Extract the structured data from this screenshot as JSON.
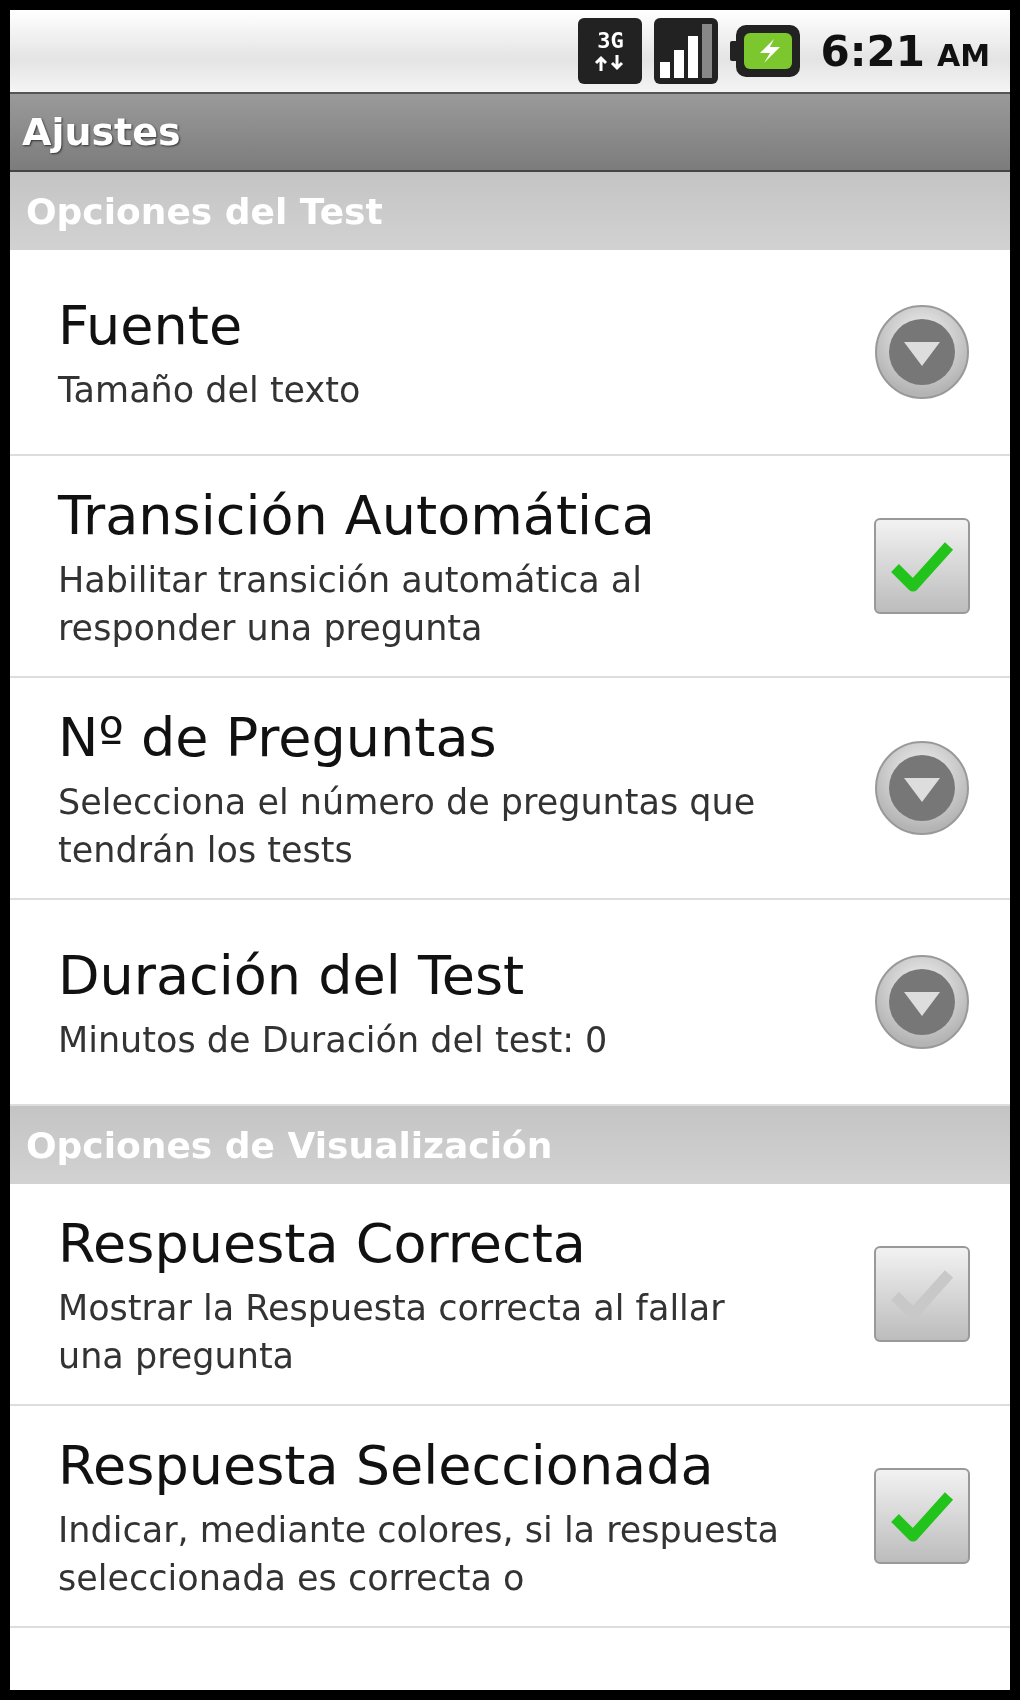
{
  "status_bar": {
    "network": "3G",
    "time": "6:21",
    "meridiem": "AM"
  },
  "title": "Ajustes",
  "sections": [
    {
      "header": "Opciones del Test",
      "items": [
        {
          "kind": "list",
          "title": "Fuente",
          "summary": "Tamaño del texto"
        },
        {
          "kind": "checkbox",
          "title": "Transición Automática",
          "summary": "Habilitar transición automática al responder una pregunta",
          "checked": true
        },
        {
          "kind": "list",
          "title": "Nº de Preguntas",
          "summary": "Selecciona el número de preguntas que tendrán los tests"
        },
        {
          "kind": "list",
          "title": "Duración del Test",
          "summary": "Minutos de Duración del test: 0"
        }
      ]
    },
    {
      "header": "Opciones de Visualización",
      "items": [
        {
          "kind": "checkbox",
          "title": "Respuesta Correcta",
          "summary": "Mostrar la Respuesta correcta al fallar una pregunta",
          "checked": false
        },
        {
          "kind": "checkbox",
          "title": "Respuesta Seleccionada",
          "summary": "Indicar, mediante colores, si la respuesta seleccionada es correcta o",
          "checked": true
        }
      ]
    }
  ]
}
